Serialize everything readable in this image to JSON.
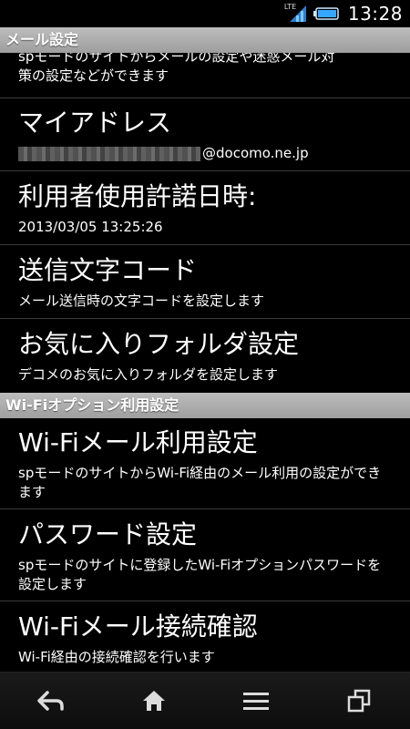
{
  "status": {
    "network": "LTE",
    "time": "13:28"
  },
  "sections": [
    {
      "header": "メール設定",
      "items": [
        {
          "title": "",
          "subtitle_line1": "spモードのサイトからメールの設定や迷惑メール対",
          "subtitle_line2": "策の設定などができます"
        },
        {
          "title": "マイアドレス",
          "subtitle": "@docomo.ne.jp"
        },
        {
          "title": "利用者使用許諾日時:",
          "subtitle": "2013/03/05 13:25:26"
        },
        {
          "title": "送信文字コード",
          "subtitle": "メール送信時の文字コードを設定します"
        },
        {
          "title": "お気に入りフォルダ設定",
          "subtitle": "デコメのお気に入りフォルダを設定します"
        }
      ]
    },
    {
      "header": "Wi-Fiオプション利用設定",
      "items": [
        {
          "title": "Wi-Fiメール利用設定",
          "subtitle": "spモードのサイトからWi-Fi経由のメール利用の設定ができます"
        },
        {
          "title": "パスワード設定",
          "subtitle": "spモードのサイトに登録したWi-Fiオプションパスワードを設定します"
        },
        {
          "title": "Wi-Fiメール接続確認",
          "subtitle": "Wi-Fi経由の接続確認を行います"
        }
      ]
    }
  ],
  "nav": {
    "back": "back-icon",
    "home": "home-icon",
    "menu": "menu-icon",
    "recent": "recent-apps-icon"
  }
}
